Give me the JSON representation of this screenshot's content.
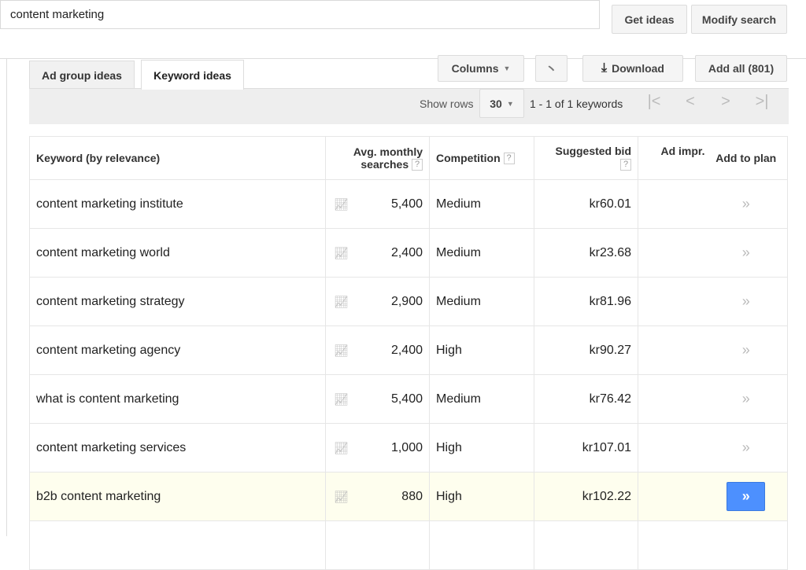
{
  "search": {
    "value": "content marketing",
    "get_ideas": "Get ideas",
    "modify_search": "Modify search"
  },
  "tabs": [
    {
      "label": "Ad group ideas",
      "active": false
    },
    {
      "label": "Keyword ideas",
      "active": true
    }
  ],
  "toolbar": {
    "columns": "Columns",
    "download": "Download",
    "add_all": "Add all (801)"
  },
  "pager": {
    "show_rows_label": "Show rows",
    "rows": "30",
    "range": "1 - 1 of 1 keywords"
  },
  "table": {
    "headers": {
      "keyword": "Keyword (by relevance)",
      "searches_1": "Avg. monthly",
      "searches_2": "searches",
      "competition": "Competition",
      "bid": "Suggested bid",
      "impr": "Ad impr.",
      "add": "Add to plan",
      "help": "?"
    },
    "rows": [
      {
        "keyword": "content marketing institute",
        "searches": "5,400",
        "competition": "Medium",
        "bid": "kr60.01"
      },
      {
        "keyword": "content marketing world",
        "searches": "2,400",
        "competition": "Medium",
        "bid": "kr23.68"
      },
      {
        "keyword": "content marketing strategy",
        "searches": "2,900",
        "competition": "Medium",
        "bid": "kr81.96"
      },
      {
        "keyword": "content marketing agency",
        "searches": "2,400",
        "competition": "High",
        "bid": "kr90.27"
      },
      {
        "keyword": "what is content marketing",
        "searches": "5,400",
        "competition": "Medium",
        "bid": "kr76.42"
      },
      {
        "keyword": "content marketing services",
        "searches": "1,000",
        "competition": "High",
        "bid": "kr107.01"
      },
      {
        "keyword": "b2b content marketing",
        "searches": "880",
        "competition": "High",
        "bid": "kr102.22",
        "highlighted": true
      }
    ]
  },
  "colors": {
    "accent": "#4d90fe",
    "highlight_row": "#fefeee"
  }
}
